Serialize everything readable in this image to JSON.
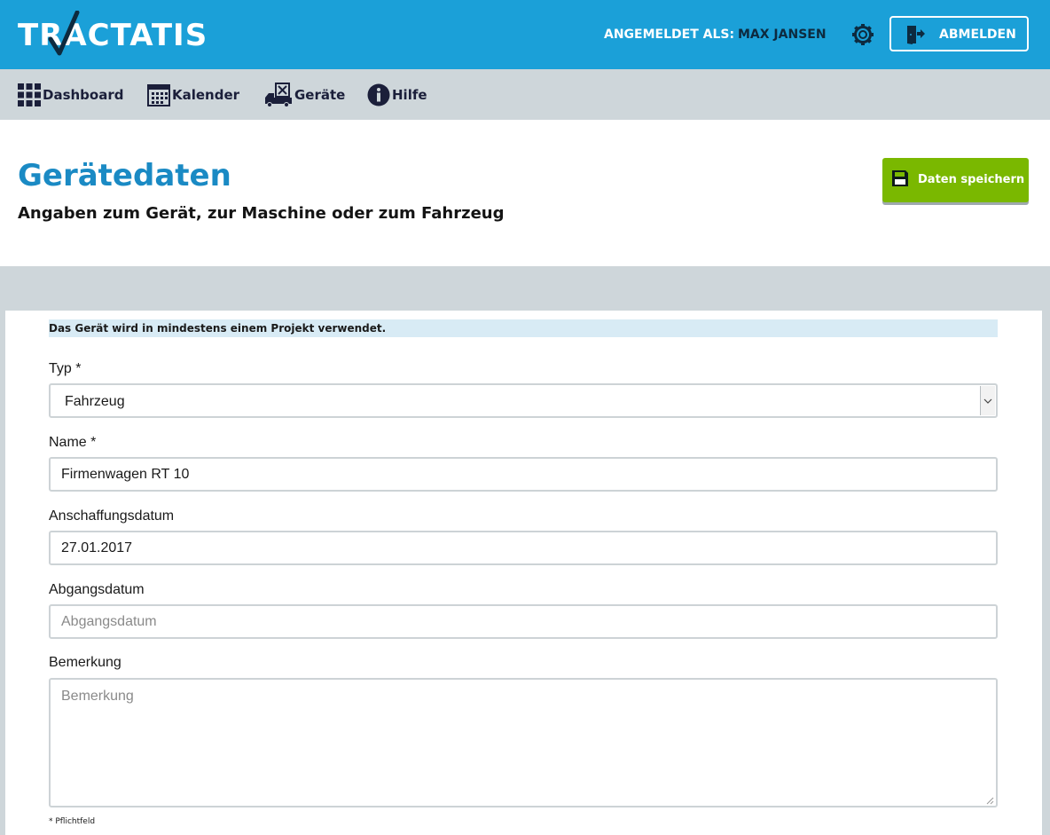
{
  "header": {
    "logo_text": "TRACTATIS",
    "login_label": "ANGEMELDET ALS:",
    "user_name": "MAX JANSEN",
    "settings_icon": "gear-icon",
    "logout_label": "ABMELDEN",
    "logout_icon": "door-exit-icon"
  },
  "nav": {
    "items": [
      {
        "label": "Dashboard",
        "icon": "grid-icon"
      },
      {
        "label": "Kalender",
        "icon": "calendar-icon"
      },
      {
        "label": "Geräte",
        "icon": "truck-icon"
      },
      {
        "label": "Hilfe",
        "icon": "info-icon"
      }
    ]
  },
  "page": {
    "title": "Gerätedaten",
    "subtitle": "Angaben zum Gerät, zur Maschine oder zum Fahrzeug",
    "save_label": "Daten speichern",
    "save_icon": "floppy-disk-icon"
  },
  "form": {
    "notice": "Das Gerät wird in mindestens einem Projekt verwendet.",
    "typ": {
      "label": "Typ *",
      "value": "Fahrzeug"
    },
    "name": {
      "label": "Name *",
      "value": "Firmenwagen RT 10"
    },
    "anschaffungsdatum": {
      "label": "Anschaffungsdatum",
      "value": "27.01.2017"
    },
    "abgangsdatum": {
      "label": "Abgangsdatum",
      "placeholder": "Abgangsdatum",
      "value": ""
    },
    "bemerkung": {
      "label": "Bemerkung",
      "placeholder": "Bemerkung",
      "value": ""
    },
    "footnote": "* Pflichtfeld"
  },
  "colors": {
    "header_blue": "#1ba0d8",
    "nav_grey": "#ced6da",
    "title_blue": "#1a8ac4",
    "save_green": "#7ab800",
    "notice_bg": "#d8ebf5"
  }
}
